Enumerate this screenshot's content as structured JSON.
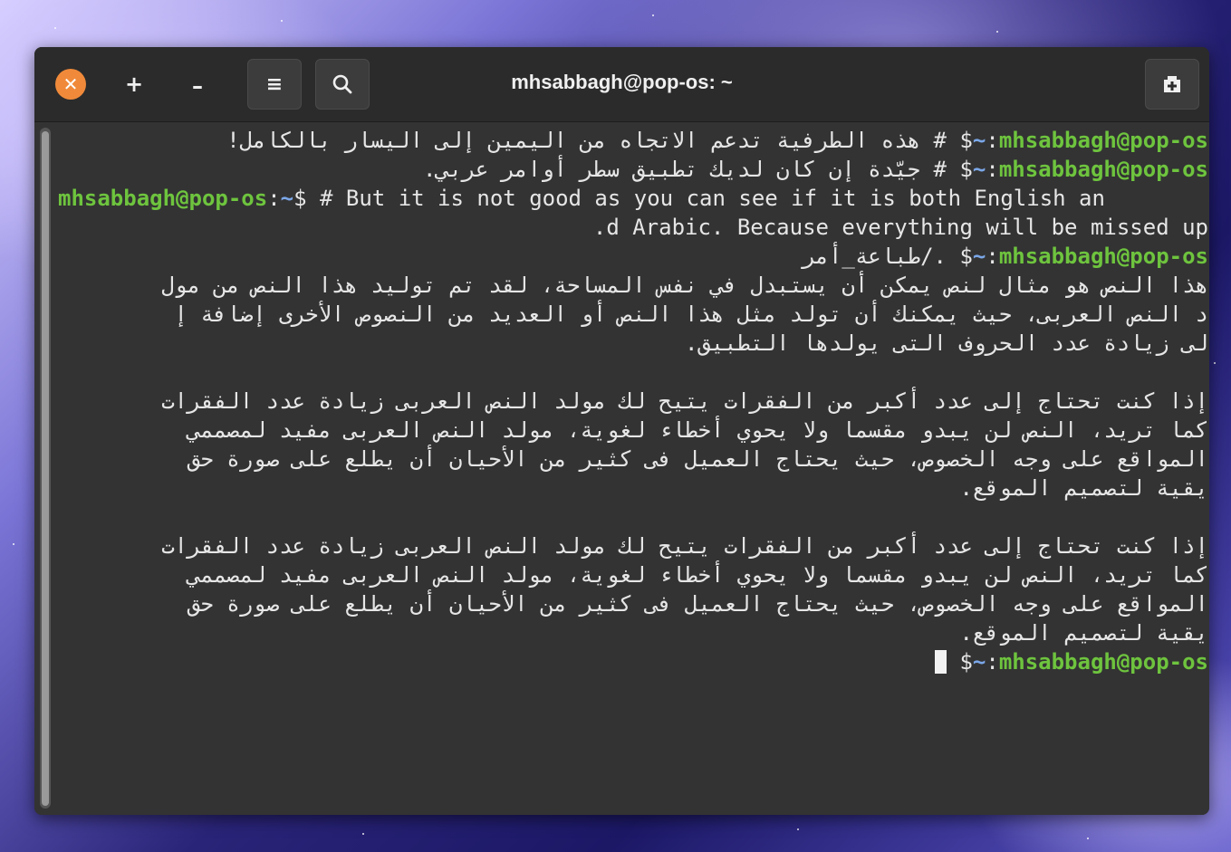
{
  "window": {
    "title": "mhsabbagh@pop-os: ~"
  },
  "headerbar": {
    "close_label": "✕",
    "add_label": "+",
    "minus_label": "–",
    "menu_label": "≡",
    "icons": [
      "close-icon",
      "plus-icon",
      "minus-icon",
      "hamburger-menu-icon",
      "search-icon",
      "new-tab-icon"
    ]
  },
  "prompt": {
    "user": "mhsabbagh@pop-os",
    "path_sep": ":",
    "path": "~",
    "symbol": "$"
  },
  "terminal": {
    "line1_text": "# هذه الطرفية تدعم الاتجاه من اليمين إلى اليسار بالكامل!",
    "line2_text": "# جيّدة إن كان لديك تطبيق سطر أوامر عربي.",
    "line3_text": "# But it is not good as you can see if it is both English an",
    "line4_text": ".d Arabic. Because everything will be missed up",
    "line5_text": "./طباعة_أمر",
    "line6_text": "هذا النص هو مثال لنص يمكن أن يستبدل في نفس المساحة، لقد تم توليد هذا النص من مول",
    "line7_text": "د النص العربى، حيث يمكنك أن تولد مثل هذا النص أو العديد من النصوص الأخرى إضافة إ",
    "line8_text": "لى زيادة عدد الحروف التى يولدها التطبيق.",
    "line10_text": "إذا كنت تحتاج إلى عدد أكبر من الفقرات يتيح لك مولد النص العربى زيادة عدد الفقرات",
    "line11_text": "كما تريد، النص لن يبدو مقسما ولا يحوي أخطاء لغوية، مولد النص العربى مفيد لمصممي",
    "line12_text": "المواقع على وجه الخصوص، حيث يحتاج العميل فى كثير من الأحيان أن يطلع على صورة حق",
    "line13_text": "يقية لتصميم الموقع.",
    "line15_text": "إذا كنت تحتاج إلى عدد أكبر من الفقرات يتيح لك مولد النص العربى زيادة عدد الفقرات",
    "line16_text": "كما تريد، النص لن يبدو مقسما ولا يحوي أخطاء لغوية، مولد النص العربى مفيد لمصممي",
    "line17_text": "المواقع على وجه الخصوص، حيث يحتاج العميل فى كثير من الأحيان أن يطلع على صورة حق",
    "line18_text": "يقية لتصميم الموقع."
  },
  "colors": {
    "prompt_user": "#6ec43e",
    "prompt_path": "#7ba7e8",
    "text": "#e6e6e6",
    "background": "#333333",
    "close_button": "#f08a3a"
  }
}
